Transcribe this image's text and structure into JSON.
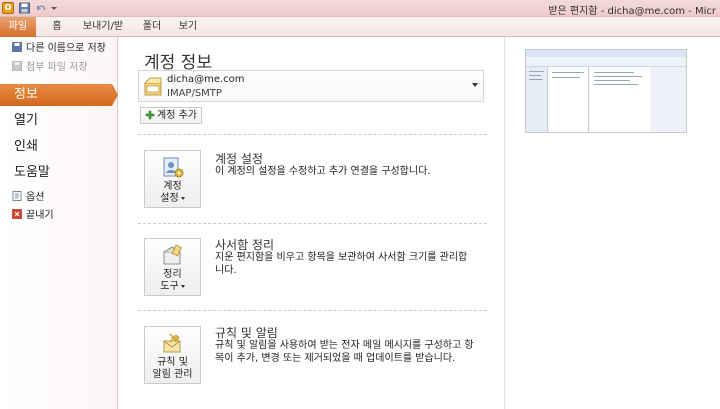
{
  "window": {
    "title": "받은 편지함 - dicha@me.com  -  Micr"
  },
  "ribbon": {
    "tabs": [
      {
        "label": "파일"
      },
      {
        "label": "홈"
      },
      {
        "label": "보내기/받기"
      },
      {
        "label": "폴더"
      },
      {
        "label": "보기"
      }
    ]
  },
  "backstage": {
    "small_items": [
      {
        "label": "다른 이름으로 저장",
        "icon": "save-as-icon",
        "enabled": true
      },
      {
        "label": "첨부 파일 저장",
        "icon": "attachment-save-icon",
        "enabled": false
      }
    ],
    "nav_items": [
      {
        "label": "정보",
        "selected": true
      },
      {
        "label": "열기",
        "selected": false
      },
      {
        "label": "인쇄",
        "selected": false
      },
      {
        "label": "도움말",
        "selected": false
      }
    ],
    "bottom_items": [
      {
        "label": "옵션",
        "icon": "options-icon"
      },
      {
        "label": "끝내기",
        "icon": "exit-icon"
      }
    ]
  },
  "main": {
    "title": "계정 정보",
    "account": {
      "email": "dicha@me.com",
      "type": "IMAP/SMTP"
    },
    "add_account_label": "계정 추가",
    "sections": [
      {
        "button_line1": "계정",
        "button_line2": "설정",
        "title": "계정 설정",
        "description": "이 계정의 설정을 수정하고 추가 연결을 구성합니다."
      },
      {
        "button_line1": "정리",
        "button_line2": "도구",
        "title": "사서함 정리",
        "description": "지운 편지함을 비우고 항목을 보관하여 사서함 크기를 관리합니다."
      },
      {
        "button_line1": "규칙 및",
        "button_line2": "알림 관리",
        "title": "규칙 및 알림",
        "description": "규칙 및 알림을 사용하여 받는 전자 메일 메시지를 구성하고 항목이 추가, 변경 또는 제거되었을 때 업데이트를 받습니다."
      }
    ]
  },
  "colors": {
    "accent_orange": "#d96f28",
    "titlebar_pink": "#f0cfcf"
  }
}
